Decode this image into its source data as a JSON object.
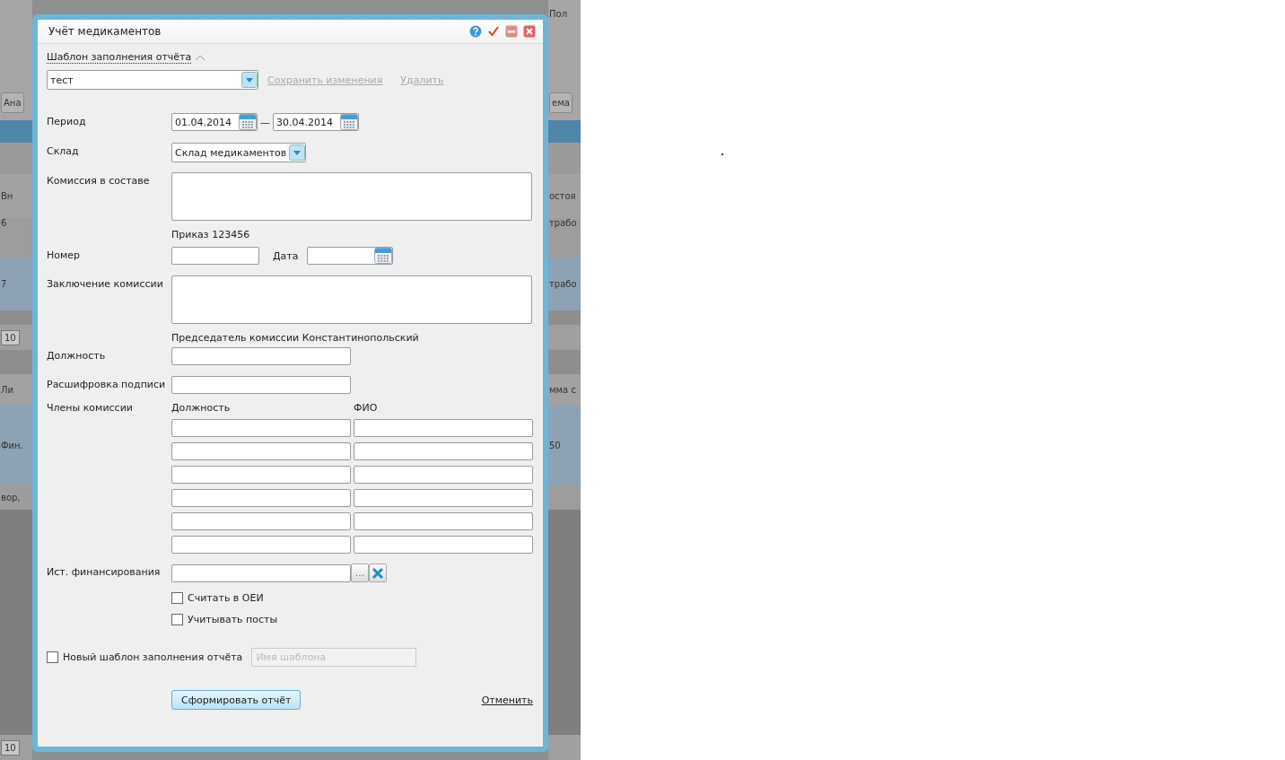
{
  "background": {
    "left": [
      {
        "kind": "top"
      },
      {
        "kind": "toolbar",
        "text": "Ана"
      },
      {
        "kind": "band"
      },
      {
        "kind": "bar"
      },
      {
        "kind": "header",
        "text": "Вн"
      },
      {
        "kind": "row",
        "text": "6"
      },
      {
        "kind": "selected",
        "text": "7"
      },
      {
        "kind": "gap"
      },
      {
        "kind": "pager",
        "text": "10"
      },
      {
        "kind": "gap2"
      },
      {
        "kind": "header2",
        "text": "Ли"
      },
      {
        "kind": "selected2",
        "text": "Фин."
      },
      {
        "kind": "row2",
        "text": "вор,"
      },
      {
        "kind": "dark"
      },
      {
        "kind": "pager",
        "text": "10"
      }
    ],
    "right": [
      {
        "kind": "top",
        "text": "Пол"
      },
      {
        "kind": "toolbar",
        "text": "ема"
      },
      {
        "kind": "band"
      },
      {
        "kind": "bar"
      },
      {
        "kind": "header",
        "text": "остоя"
      },
      {
        "kind": "row",
        "text": "трабо"
      },
      {
        "kind": "selected",
        "text": "трабо"
      },
      {
        "kind": "gap"
      },
      {
        "kind": "pager"
      },
      {
        "kind": "gap2"
      },
      {
        "kind": "header2",
        "text": "мма с"
      },
      {
        "kind": "selected2",
        "text": "50"
      },
      {
        "kind": "row2"
      },
      {
        "kind": "dark"
      },
      {
        "kind": "pager"
      }
    ]
  },
  "dialog": {
    "title": "Учёт медикаментов",
    "template": {
      "label": "Шаблон заполнения отчёта",
      "expanded": true,
      "value": "тест",
      "links": [
        {
          "text": "Сохранить изменения",
          "disabled": true
        },
        {
          "text": "Удалить",
          "disabled": true
        }
      ]
    },
    "period": {
      "label": "Период",
      "from": "01.04.2014",
      "separator": "—",
      "to": "30.04.2014"
    },
    "warehouse": {
      "label": "Склад",
      "value": "Склад медикаментов"
    },
    "commission": {
      "label": "Комиссия в составе"
    },
    "order_caption": "Приказ 123456",
    "number": {
      "label": "Номер"
    },
    "date": {
      "label": "Дата"
    },
    "conclusion": {
      "label": "Заключение комиссии"
    },
    "chairman_caption": "Председатель комиссии Константинопольский",
    "position": {
      "label": "Должность"
    },
    "signature": {
      "label": "Расшифровка подписи"
    },
    "members": {
      "label": "Члены комиссии",
      "columns": [
        "Должность",
        "ФИО"
      ],
      "rows": [
        {
          "kind": "blank"
        },
        {
          "kind": "blank"
        },
        {
          "kind": "blank"
        },
        {
          "kind": "blank"
        },
        {
          "kind": "blank"
        },
        {
          "kind": "blank"
        }
      ]
    },
    "funding": {
      "label": "Ист. финансирования",
      "browse": "..."
    },
    "options": [
      {
        "label": "Считать в ОЕИ",
        "checked": false
      },
      {
        "label": "Учитывать посты",
        "checked": false
      }
    ],
    "new_template": {
      "label": "Новый шаблон заполнения отчёта",
      "checked": false,
      "placeholder": "Имя шаблона",
      "disabled": true
    },
    "submit": "Сформировать отчёт",
    "cancel": "Отменить"
  }
}
